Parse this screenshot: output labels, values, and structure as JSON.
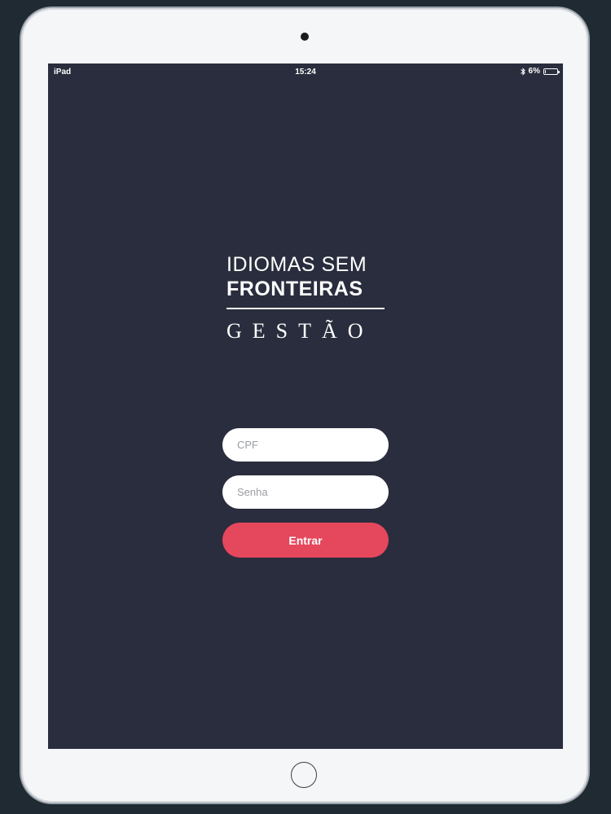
{
  "status_bar": {
    "carrier": "iPad",
    "time": "15:24",
    "battery_percent": "6%",
    "battery_level": 0.06,
    "icons": [
      "bluetooth-icon",
      "battery-icon"
    ]
  },
  "logo": {
    "line1": "IDIOMAS SEM",
    "line2": "FRONTEIRAS",
    "subtitle": "GESTÃO"
  },
  "login": {
    "cpf_placeholder": "CPF",
    "cpf_value": "",
    "password_placeholder": "Senha",
    "password_value": "",
    "submit_label": "Entrar"
  },
  "colors": {
    "background": "#2a2d3d",
    "accent": "#e5475d",
    "input_background": "#ffffff",
    "device_frame": "#f5f6f8"
  }
}
